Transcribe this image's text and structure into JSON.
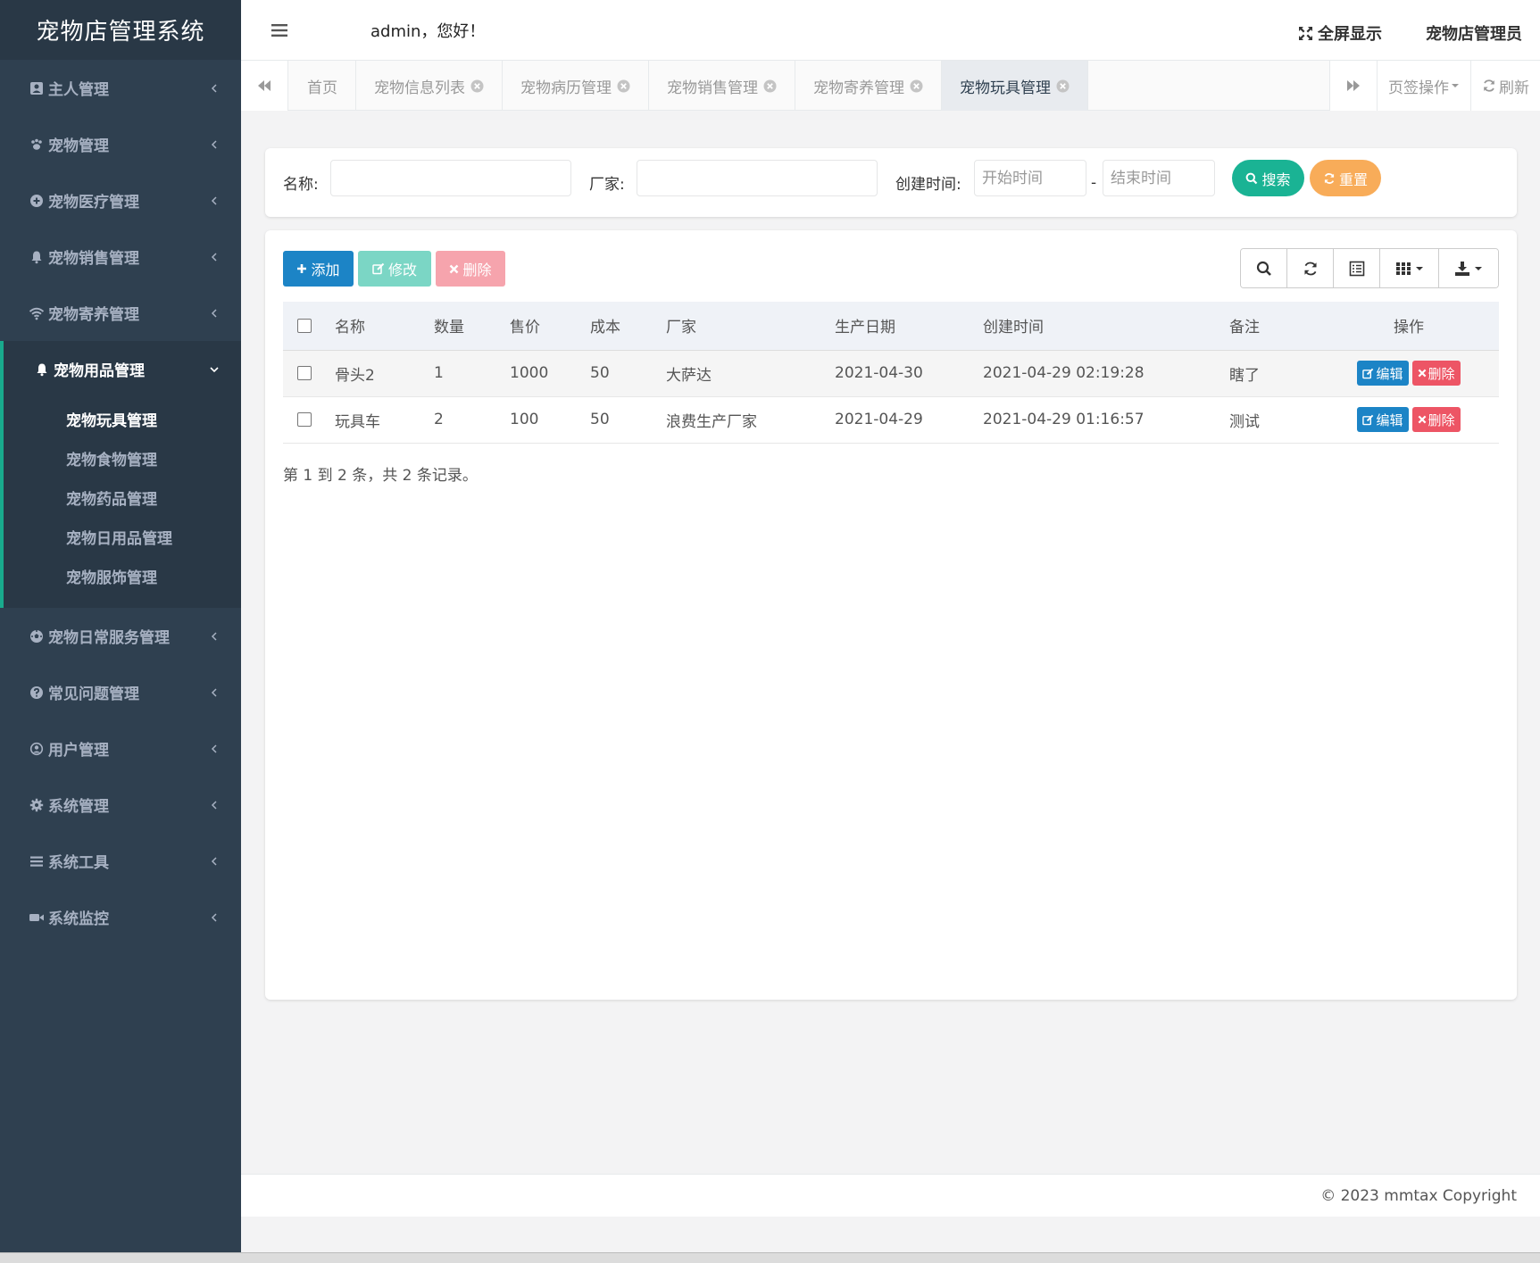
{
  "app": {
    "title": "宠物店管理系统"
  },
  "topbar": {
    "welcome": "admin，您好！",
    "fullscreen_label": "全屏显示",
    "user_label": "宠物店管理员"
  },
  "sidebar": {
    "items": [
      {
        "label": "主人管理",
        "icon": "id-card-icon"
      },
      {
        "label": "宠物管理",
        "icon": "paw-icon"
      },
      {
        "label": "宠物医疗管理",
        "icon": "plus-circle-icon"
      },
      {
        "label": "宠物销售管理",
        "icon": "bell-icon"
      },
      {
        "label": "宠物寄养管理",
        "icon": "wifi-icon"
      },
      {
        "label": "宠物用品管理",
        "icon": "bell-icon",
        "expanded": true
      },
      {
        "label": "宠物日常服务管理",
        "icon": "soccer-icon"
      },
      {
        "label": "常见问题管理",
        "icon": "question-circle-icon"
      },
      {
        "label": "用户管理",
        "icon": "user-circle-icon"
      },
      {
        "label": "系统管理",
        "icon": "gear-icon"
      },
      {
        "label": "系统工具",
        "icon": "bars-icon"
      },
      {
        "label": "系统监控",
        "icon": "video-camera-icon"
      }
    ],
    "submenu": [
      {
        "label": "宠物玩具管理",
        "active": true
      },
      {
        "label": "宠物食物管理"
      },
      {
        "label": "宠物药品管理"
      },
      {
        "label": "宠物日用品管理"
      },
      {
        "label": "宠物服饰管理"
      }
    ]
  },
  "tabs": {
    "items": [
      {
        "label": "首页",
        "closable": false
      },
      {
        "label": "宠物信息列表",
        "closable": true
      },
      {
        "label": "宠物病历管理",
        "closable": true
      },
      {
        "label": "宠物销售管理",
        "closable": true
      },
      {
        "label": "宠物寄养管理",
        "closable": true
      },
      {
        "label": "宠物玩具管理",
        "closable": true,
        "active": true
      }
    ],
    "tab_ops_label": "页签操作",
    "refresh_label": "刷新"
  },
  "search": {
    "name_label": "名称:",
    "vendor_label": "厂家:",
    "created_label": "创建时间:",
    "name_value": "",
    "vendor_value": "",
    "start_placeholder": "开始时间",
    "end_placeholder": "结束时间",
    "range_sep": "-",
    "search_button": "搜索",
    "reset_button": "重置"
  },
  "toolbar": {
    "add_label": "添加",
    "edit_label": "修改",
    "delete_label": "删除"
  },
  "table": {
    "columns": [
      "名称",
      "数量",
      "售价",
      "成本",
      "厂家",
      "生产日期",
      "创建时间",
      "备注",
      "操作"
    ],
    "rows": [
      {
        "name": "骨头2",
        "qty": "1",
        "price": "1000",
        "cost": "50",
        "vendor": "大萨达",
        "prod_date": "2021-04-30",
        "created": "2021-04-29 02:19:28",
        "remark": "瞎了"
      },
      {
        "name": "玩具车",
        "qty": "2",
        "price": "100",
        "cost": "50",
        "vendor": "浪费生产厂家",
        "prod_date": "2021-04-29",
        "created": "2021-04-29 01:16:57",
        "remark": "测试"
      }
    ],
    "edit_label": "编辑",
    "delete_label": "删除",
    "summary": "第 1 到 2 条，共 2 条记录。"
  },
  "footer": {
    "copyright": "© 2023 mmtax Copyright"
  },
  "colors": {
    "sidebar": "#2f4050",
    "primary": "#1c84c6",
    "success": "#1ab394",
    "warning": "#f8ac59",
    "danger": "#ed5565",
    "accent_border": "#19aa8d"
  }
}
